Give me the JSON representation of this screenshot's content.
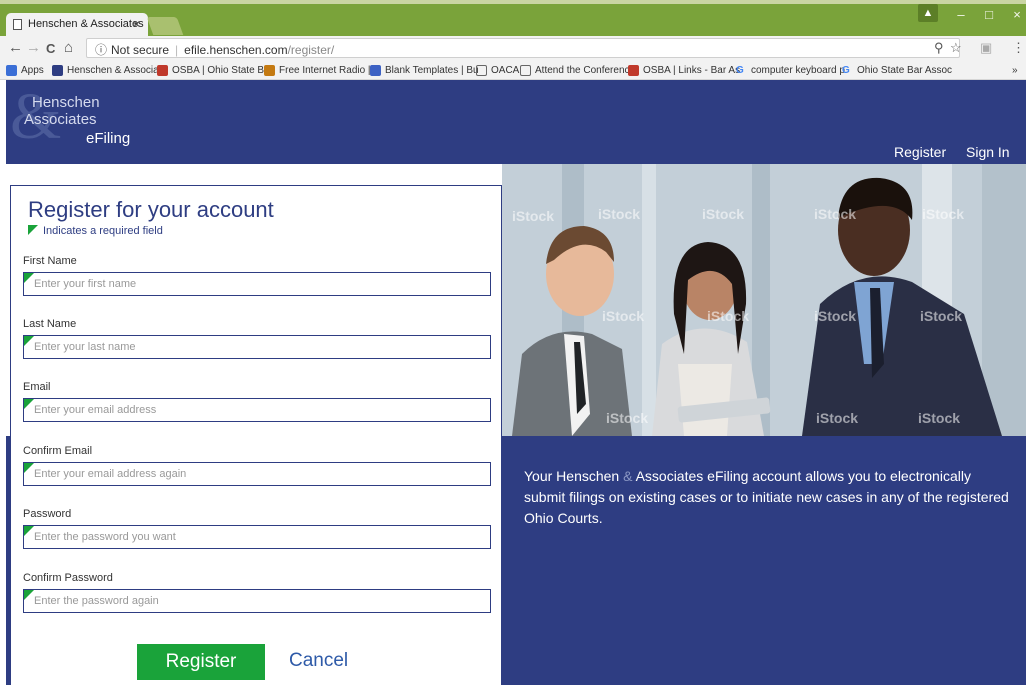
{
  "browser": {
    "tab_title": "Henschen & Associates",
    "tab_close": "×",
    "window_controls": {
      "minimize": "–",
      "maximize": "□",
      "close": "×"
    },
    "nav": {
      "back": "←",
      "forward": "→",
      "reload": "C",
      "home": "⌂"
    },
    "address": {
      "security_label": "Not secure",
      "host": "efile.henschen.com",
      "path": "/register/"
    },
    "bookmarks": [
      {
        "label": "Apps",
        "icon": "apps-grid-icon",
        "color": "#3b6fd6"
      },
      {
        "label": "Henschen & Associat",
        "icon": "ha-logo-icon",
        "color": "#2e3d82"
      },
      {
        "label": "OSBA | Ohio State Ba",
        "icon": "osba-icon",
        "color": "#c0392b"
      },
      {
        "label": "Free Internet Radio | ",
        "icon": "radio-icon",
        "color": "#c47a12"
      },
      {
        "label": "Blank Templates | Bu",
        "icon": "templates-icon",
        "color": "#3d62c4"
      },
      {
        "label": "OACA",
        "icon": "page-icon",
        "color": "#ffffff"
      },
      {
        "label": "Attend the Conferenc",
        "icon": "page-icon",
        "color": "#ffffff"
      },
      {
        "label": "OSBA | Links - Bar As",
        "icon": "osba-icon",
        "color": "#c0392b"
      },
      {
        "label": "computer keyboard p",
        "icon": "google-icon",
        "color": "#4285f4"
      },
      {
        "label": "Ohio State Bar Assoc",
        "icon": "google-icon",
        "color": "#4285f4"
      }
    ],
    "bookmarks_overflow": "»"
  },
  "header": {
    "logo": {
      "amp": "&",
      "line1": "Henschen",
      "line2": "Associates",
      "line3": "eFiling"
    },
    "nav": {
      "register": "Register",
      "sign_in": "Sign In"
    }
  },
  "form": {
    "title": "Register for your account",
    "required_note": "Indicates a required field",
    "fields": [
      {
        "label": "First Name",
        "placeholder": "Enter your first name",
        "value": ""
      },
      {
        "label": "Last Name",
        "placeholder": "Enter your last name",
        "value": ""
      },
      {
        "label": "Email",
        "placeholder": "Enter your email address",
        "value": ""
      },
      {
        "label": "Confirm Email",
        "placeholder": "Enter your email address again",
        "value": ""
      },
      {
        "label": "Password",
        "placeholder": "Enter the password you want",
        "value": ""
      },
      {
        "label": "Confirm Password",
        "placeholder": "Enter the password again",
        "value": ""
      }
    ],
    "register_button": "Register",
    "cancel_link": "Cancel"
  },
  "info": {
    "text_before": "Your Henschen ",
    "amp": "&",
    "text_after": " Associates eFiling account allows you to electronically submit filings on existing cases or to initiate new cases in any of the registered Ohio Courts."
  },
  "photo": {
    "watermark": "iStock"
  },
  "colors": {
    "brand_navy": "#2e3d82",
    "accent_green": "#1aa33a",
    "chrome_green": "#7aa33a",
    "link_blue": "#2e5aa8"
  }
}
